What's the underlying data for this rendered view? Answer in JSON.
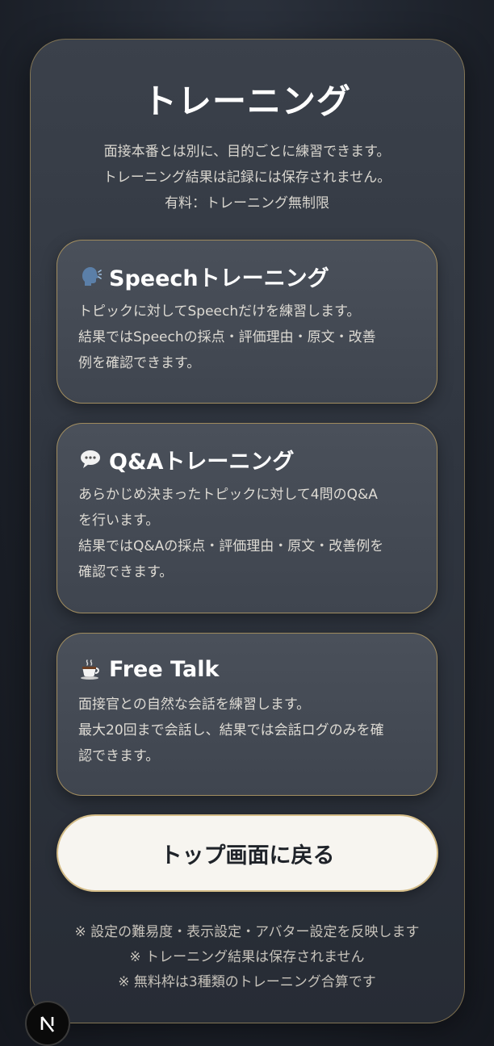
{
  "page": {
    "title": "トレーニング",
    "intro": [
      "面接本番とは別に、目的ごとに練習できます。",
      "トレーニング結果は記録には保存されません。",
      "有料：トレーニング無制限"
    ]
  },
  "cards": [
    {
      "icon": "speaking-head-icon",
      "title": "Speechトレーニング",
      "desc": [
        "トピックに対してSpeechだけを練習します。",
        "結果ではSpeechの採点・評価理由・原文・改善",
        "例を確認できます。"
      ]
    },
    {
      "icon": "speech-bubble-icon",
      "title": "Q&Aトレーニング",
      "desc": [
        "あらかじめ決まったトピックに対して4問のQ&A",
        "を行います。",
        "結果ではQ&Aの採点・評価理由・原文・改善例を",
        "確認できます。"
      ]
    },
    {
      "icon": "coffee-cup-icon",
      "title": "Free Talk",
      "desc": [
        "面接官との自然な会話を練習します。",
        "最大20回まで会話し、結果では会話ログのみを確",
        "認できます。"
      ]
    }
  ],
  "back_button": {
    "label": "トップ画面に戻る"
  },
  "notes": [
    "※ 設定の難易度・表示設定・アバター設定を反映します",
    "※ トレーニング結果は保存されません",
    "※ 無料枠は3種類のトレーニング合算です"
  ],
  "badge": {
    "letter": "N",
    "icon": "nextjs-logo-icon"
  },
  "colors": {
    "accent_border": "#c8a864",
    "panel_bg": "#353b45",
    "button_bg": "#f7f5f0"
  }
}
